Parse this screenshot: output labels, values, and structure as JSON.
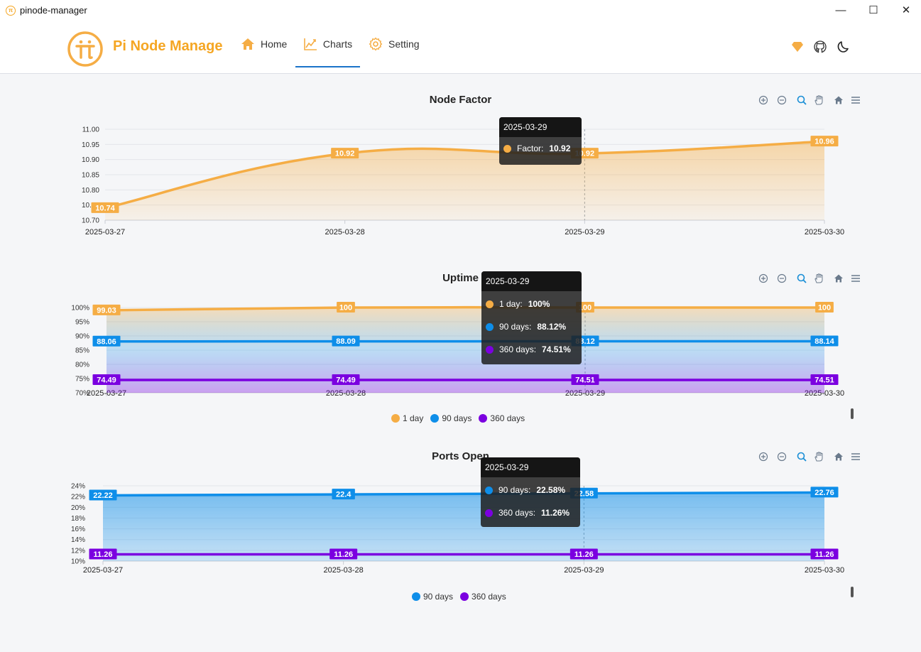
{
  "window": {
    "title": "pinode-manager",
    "minimize": "—",
    "maximize": "☐",
    "close": "✕"
  },
  "nav": {
    "brand": "Pi Node Manage",
    "items": [
      {
        "label": "Home"
      },
      {
        "label": "Charts"
      },
      {
        "label": "Setting"
      }
    ]
  },
  "colors": {
    "orange": "#f5ad45",
    "blue": "#0e8ee9",
    "purple": "#7b00e0"
  },
  "charts": [
    {
      "title": "Node Factor",
      "tooltip": {
        "date": "2025-03-29",
        "rows": [
          {
            "label": "Factor:",
            "value": "10.92"
          }
        ]
      }
    },
    {
      "title": "Uptime",
      "tooltip": {
        "date": "2025-03-29",
        "rows": [
          {
            "label": "1 day:",
            "value": "100%"
          },
          {
            "label": "90 days:",
            "value": "88.12%"
          },
          {
            "label": "360 days:",
            "value": "74.51%"
          }
        ]
      },
      "legend": [
        "1 day",
        "90 days",
        "360 days"
      ]
    },
    {
      "title": "Ports Open",
      "tooltip": {
        "date": "2025-03-29",
        "rows": [
          {
            "label": "90 days:",
            "value": "22.58%"
          },
          {
            "label": "360 days:",
            "value": "11.26%"
          }
        ]
      },
      "legend": [
        "90 days",
        "360 days"
      ]
    }
  ],
  "chart_data": [
    {
      "type": "area",
      "title": "Node Factor",
      "x": [
        "2025-03-27",
        "2025-03-28",
        "2025-03-29",
        "2025-03-30"
      ],
      "series": [
        {
          "name": "Factor",
          "values": [
            10.74,
            10.92,
            10.92,
            10.96
          ],
          "labels": [
            "10.74",
            "10.92",
            "10.92",
            "10.96"
          ]
        }
      ],
      "yticks": [
        "10.70",
        "10.75",
        "10.80",
        "10.85",
        "10.90",
        "10.95",
        "11.00"
      ],
      "ylim": [
        10.7,
        11.0
      ],
      "grid": true
    },
    {
      "type": "area",
      "title": "Uptime",
      "x": [
        "2025-03-27",
        "2025-03-28",
        "2025-03-29",
        "2025-03-30"
      ],
      "series": [
        {
          "name": "1 day",
          "values": [
            99.03,
            100,
            100,
            100
          ],
          "labels": [
            "99.03",
            "100",
            "100",
            "100"
          ]
        },
        {
          "name": "90 days",
          "values": [
            88.06,
            88.09,
            88.12,
            88.14
          ],
          "labels": [
            "88.06",
            "88.09",
            "88.12",
            "88.14"
          ]
        },
        {
          "name": "360 days",
          "values": [
            74.49,
            74.49,
            74.51,
            74.51
          ],
          "labels": [
            "74.49",
            "74.49",
            "74.51",
            "74.51"
          ]
        }
      ],
      "yticks": [
        "70%",
        "75%",
        "80%",
        "85%",
        "90%",
        "95%",
        "100%"
      ],
      "ylim": [
        70,
        100
      ],
      "grid": true,
      "legend": "bottom-center"
    },
    {
      "type": "area",
      "title": "Ports Open",
      "x": [
        "2025-03-27",
        "2025-03-28",
        "2025-03-29",
        "2025-03-30"
      ],
      "series": [
        {
          "name": "90 days",
          "values": [
            22.22,
            22.4,
            22.58,
            22.76
          ],
          "labels": [
            "22.22",
            "22.4",
            "22.58",
            "22.76"
          ]
        },
        {
          "name": "360 days",
          "values": [
            11.26,
            11.26,
            11.26,
            11.26
          ],
          "labels": [
            "11.26",
            "11.26",
            "11.26",
            "11.26"
          ]
        }
      ],
      "yticks": [
        "10%",
        "12%",
        "14%",
        "16%",
        "18%",
        "20%",
        "22%",
        "24%"
      ],
      "ylim": [
        10,
        24
      ],
      "grid": true,
      "legend": "bottom-center"
    }
  ]
}
